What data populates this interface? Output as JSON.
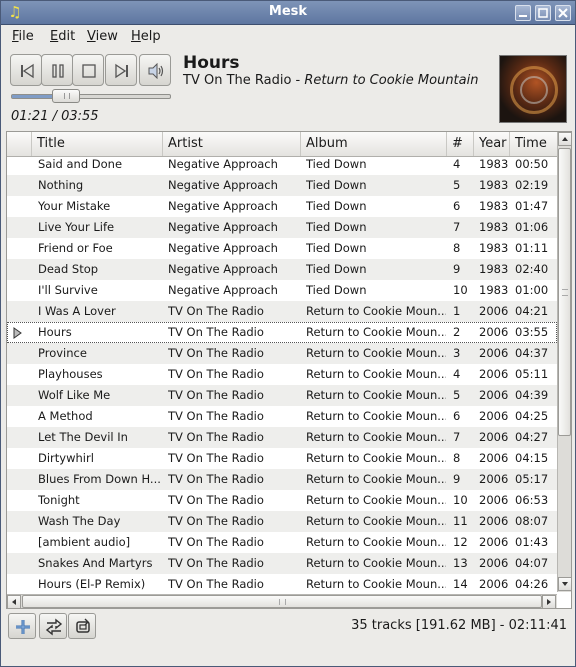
{
  "window": {
    "title": "Mesk",
    "app_icon": "music-note-icon"
  },
  "menu": [
    {
      "prefix": "",
      "accel": "F",
      "rest": "ile"
    },
    {
      "prefix": "",
      "accel": "E",
      "rest": "dit"
    },
    {
      "prefix": "",
      "accel": "V",
      "rest": "iew"
    },
    {
      "prefix": "",
      "accel": "H",
      "rest": "elp"
    }
  ],
  "player": {
    "buttons": [
      "previous-icon",
      "pause-icon",
      "stop-icon",
      "next-icon",
      "volume-icon"
    ],
    "elapsed": "01:21",
    "total": "03:55",
    "time_display": "01:21 / 03:55",
    "progress_fraction": 0.345,
    "now_playing": {
      "title": "Hours",
      "artist": "TV On The Radio",
      "separator": " - ",
      "album": "Return to Cookie Mountain"
    }
  },
  "tracklist": {
    "columns": [
      "Title",
      "Artist",
      "Album",
      "#",
      "Year",
      "Time"
    ],
    "rows": [
      {
        "title": "Said and Done",
        "artist": "Negative Approach",
        "album": "Tied Down",
        "num": "4",
        "year": "1983",
        "time": "00:50"
      },
      {
        "title": "Nothing",
        "artist": "Negative Approach",
        "album": "Tied Down",
        "num": "5",
        "year": "1983",
        "time": "02:19"
      },
      {
        "title": "Your Mistake",
        "artist": "Negative Approach",
        "album": "Tied Down",
        "num": "6",
        "year": "1983",
        "time": "01:47"
      },
      {
        "title": "Live Your Life",
        "artist": "Negative Approach",
        "album": "Tied Down",
        "num": "7",
        "year": "1983",
        "time": "01:06"
      },
      {
        "title": "Friend or Foe",
        "artist": "Negative Approach",
        "album": "Tied Down",
        "num": "8",
        "year": "1983",
        "time": "01:11"
      },
      {
        "title": "Dead Stop",
        "artist": "Negative Approach",
        "album": "Tied Down",
        "num": "9",
        "year": "1983",
        "time": "02:40"
      },
      {
        "title": "I'll Survive",
        "artist": "Negative Approach",
        "album": "Tied Down",
        "num": "10",
        "year": "1983",
        "time": "01:00"
      },
      {
        "title": "I Was A Lover",
        "artist": "TV On The Radio",
        "album": "Return to Cookie Moun...",
        "num": "1",
        "year": "2006",
        "time": "04:21"
      },
      {
        "title": "Hours",
        "artist": "TV On The Radio",
        "album": "Return to Cookie Moun...",
        "num": "2",
        "year": "2006",
        "time": "03:55"
      },
      {
        "title": "Province",
        "artist": "TV On The Radio",
        "album": "Return to Cookie Moun...",
        "num": "3",
        "year": "2006",
        "time": "04:37"
      },
      {
        "title": "Playhouses",
        "artist": "TV On The Radio",
        "album": "Return to Cookie Moun...",
        "num": "4",
        "year": "2006",
        "time": "05:11"
      },
      {
        "title": "Wolf Like Me",
        "artist": "TV On The Radio",
        "album": "Return to Cookie Moun...",
        "num": "5",
        "year": "2006",
        "time": "04:39"
      },
      {
        "title": "A Method",
        "artist": "TV On The Radio",
        "album": "Return to Cookie Moun...",
        "num": "6",
        "year": "2006",
        "time": "04:25"
      },
      {
        "title": "Let The Devil In",
        "artist": "TV On The Radio",
        "album": "Return to Cookie Moun...",
        "num": "7",
        "year": "2006",
        "time": "04:27"
      },
      {
        "title": "Dirtywhirl",
        "artist": "TV On The Radio",
        "album": "Return to Cookie Moun...",
        "num": "8",
        "year": "2006",
        "time": "04:15"
      },
      {
        "title": "Blues From Down H...",
        "artist": "TV On The Radio",
        "album": "Return to Cookie Moun...",
        "num": "9",
        "year": "2006",
        "time": "05:17"
      },
      {
        "title": "Tonight",
        "artist": "TV On The Radio",
        "album": "Return to Cookie Moun...",
        "num": "10",
        "year": "2006",
        "time": "06:53"
      },
      {
        "title": "Wash The Day",
        "artist": "TV On The Radio",
        "album": "Return to Cookie Moun...",
        "num": "11",
        "year": "2006",
        "time": "08:07"
      },
      {
        "title": "[ambient audio]",
        "artist": "TV On The Radio",
        "album": "Return to Cookie Moun...",
        "num": "12",
        "year": "2006",
        "time": "01:43"
      },
      {
        "title": "Snakes And Martyrs",
        "artist": "TV On The Radio",
        "album": "Return to Cookie Moun...",
        "num": "13",
        "year": "2006",
        "time": "04:07"
      },
      {
        "title": "Hours (El-P Remix)",
        "artist": "TV On The Radio",
        "album": "Return to Cookie Moun...",
        "num": "14",
        "year": "2006",
        "time": "04:26"
      }
    ],
    "playing_title": "Hours"
  },
  "footer": {
    "buttons": [
      "add-icon",
      "shuffle-icon",
      "repeat-icon"
    ],
    "status": "35 tracks [191.62 MB] - 02:11:41"
  },
  "colors": {
    "titlebar": "#6a82aa",
    "accent": "#7f9cc6",
    "row_alt": "#eeeeec"
  }
}
